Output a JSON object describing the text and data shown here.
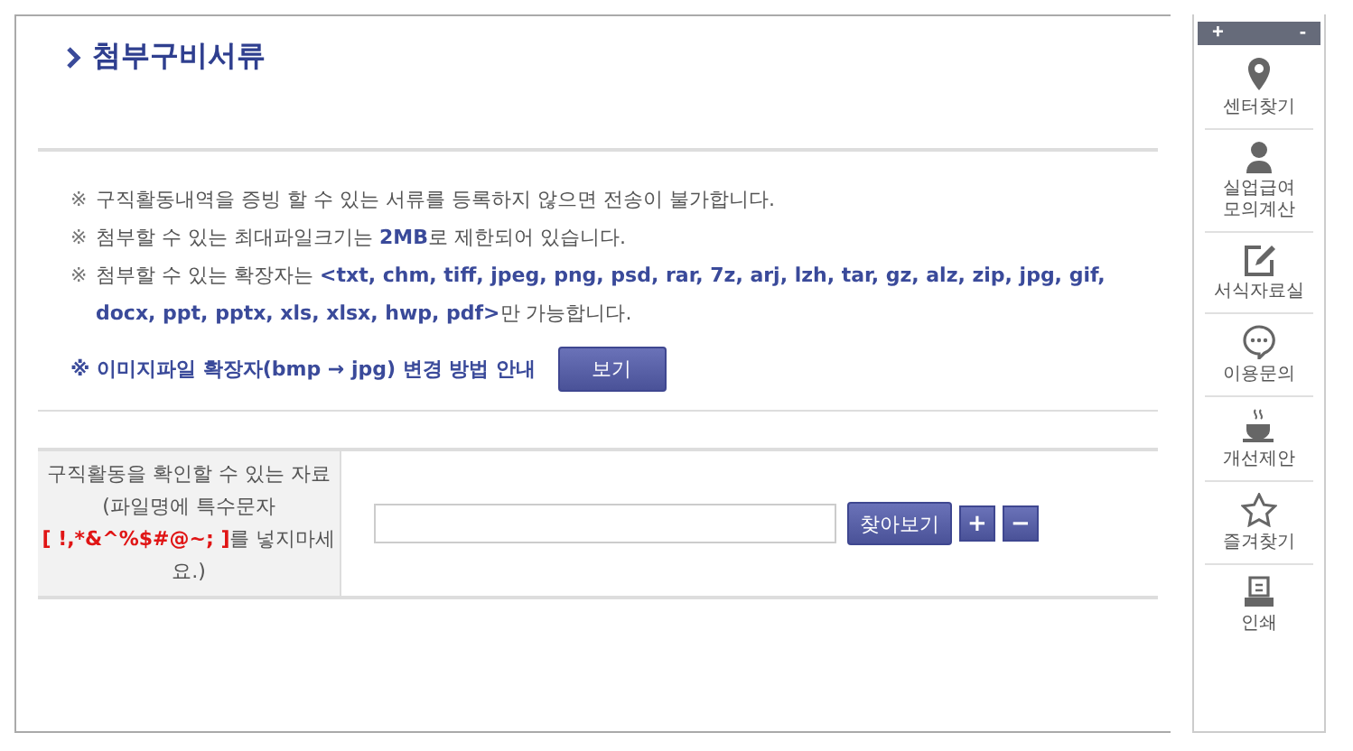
{
  "section_title": "첨부구비서류",
  "notes": [
    {
      "parts": [
        {
          "text": "구직활동내역을 증빙 할 수 있는 서류를 등록하지 않으면 전송이 불가합니다.",
          "emphasis": false
        }
      ]
    },
    {
      "parts": [
        {
          "text": "첨부할 수 있는 최대파일크기는 ",
          "emphasis": false
        },
        {
          "text": "2MB",
          "emphasis": true
        },
        {
          "text": "로 제한되어 있습니다.",
          "emphasis": false
        }
      ]
    },
    {
      "parts": [
        {
          "text": "첨부할 수 있는 확장자는 ",
          "emphasis": false
        },
        {
          "text": "<txt, chm, tiff, jpeg, png, psd, rar, 7z, arj, lzh, tar, gz, alz, zip, jpg, gif, docx, ppt, pptx, xls, xlsx, hwp, pdf>",
          "emphasis": true
        },
        {
          "text": "만 가능합니다.",
          "emphasis": false
        }
      ]
    }
  ],
  "note_mark": "※",
  "image_guide": {
    "text": "※ 이미지파일 확장자(bmp → jpg) 변경 방법 안내",
    "button": "보기"
  },
  "attach_row": {
    "label_parts": [
      {
        "text": "구직활동을 확인할 수 있는 자료 (파일명에 특수문자 ",
        "warning": false
      },
      {
        "text": "[ !,*&^%$#@~; ]",
        "warning": true
      },
      {
        "text": "를 넣지마세요.)",
        "warning": false
      }
    ],
    "browse_button": "찾아보기",
    "add_button": "+",
    "remove_button": "−"
  },
  "quick_menu": {
    "zoom_in": "+",
    "zoom_out": "-",
    "items": [
      {
        "kind": "pin",
        "label": "센터찾기"
      },
      {
        "kind": "person",
        "label": "실업급여 모의계산"
      },
      {
        "kind": "edit",
        "label": "서식자료실"
      },
      {
        "kind": "chat",
        "label": "이용문의"
      },
      {
        "kind": "cup",
        "label": "개선제안"
      },
      {
        "kind": "star",
        "label": "즐겨찾기"
      },
      {
        "kind": "print",
        "label": "인쇄"
      }
    ]
  }
}
